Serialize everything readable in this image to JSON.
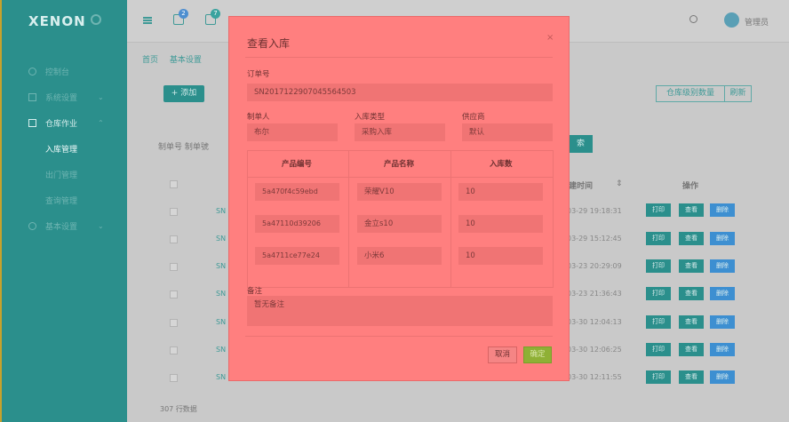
{
  "app": {
    "brand": "XENON"
  },
  "sidebar": {
    "items": [
      {
        "label": "控制台"
      },
      {
        "label": "系统设置"
      },
      {
        "label": "仓库作业"
      },
      {
        "label": "基本设置"
      }
    ],
    "subitems": [
      {
        "label": "入库管理"
      },
      {
        "label": "出门管理"
      },
      {
        "label": "查询管理"
      }
    ]
  },
  "topbar": {
    "badge1": "2",
    "badge2": "7",
    "user_name": "管理员"
  },
  "breadcrumb": {
    "home": "首页",
    "section": "基本设置"
  },
  "toolbar": {
    "add_label": "+ 添加",
    "export_label": "仓库级别数量",
    "refresh_label": "刷新"
  },
  "filter": {
    "label": "制单号  制单號"
  },
  "table": {
    "headers": {
      "time": "建时间",
      "actions": "操作"
    },
    "rows": [
      {
        "sn": "SN",
        "time": "03-29 19:18:31"
      },
      {
        "sn": "SN",
        "time": "03-29 15:12:45"
      },
      {
        "sn": "SN",
        "time": "03-23 20:29:09"
      },
      {
        "sn": "SN",
        "time": "03-23 21:36:43"
      },
      {
        "sn": "SN",
        "time": "03-30 12:04:13"
      },
      {
        "sn": "SN",
        "time": "03-30 12:06:25"
      },
      {
        "sn": "SN",
        "time": "03-30 12:11:55"
      }
    ],
    "action_labels": {
      "print": "打印",
      "view": "查看",
      "delete": "删除"
    },
    "footer": "307 行数据"
  },
  "modal": {
    "title": "查看入库",
    "close": "×",
    "order_label": "订单号",
    "order_value": "SN2017122907045564503",
    "maker_label": "制单人",
    "maker_value": "布尔",
    "type_label": "入库类型",
    "type_value": "采购入库",
    "supplier_label": "供应商",
    "supplier_value": "默认",
    "goods_headers": [
      "产品编号",
      "产品名称",
      "入库数"
    ],
    "goods": [
      {
        "code": "5a470f4c59ebd",
        "name": "荣耀V10",
        "qty": "10"
      },
      {
        "code": "5a47110d39206",
        "name": "金立s10",
        "qty": "10"
      },
      {
        "code": "5a4711ce77e24",
        "name": "小米6",
        "qty": "10"
      }
    ],
    "remark_label": "备注",
    "remark_value": "暂无备注",
    "cancel_label": "取消",
    "ok_label": "确定"
  }
}
